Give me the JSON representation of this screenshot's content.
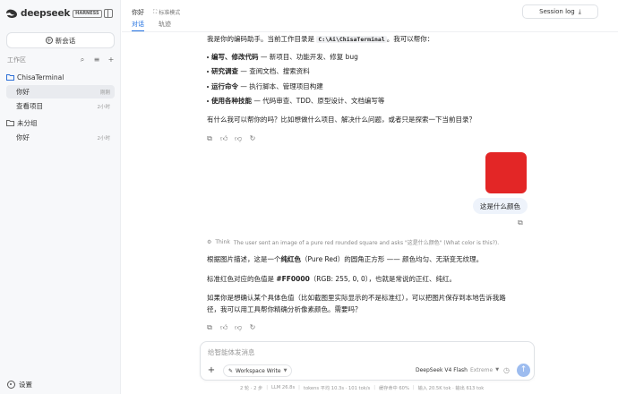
{
  "brand": {
    "name": "deepseek",
    "tag": "HARNESS"
  },
  "sidebar": {
    "new_chat": "新会话",
    "workspace_label": "工作区",
    "groups": [
      {
        "name": "ChisaTerminal",
        "items": [
          {
            "title": "你好",
            "time": "刚刚",
            "active": true
          },
          {
            "title": "查看项目",
            "time": "2小时",
            "active": false
          }
        ]
      },
      {
        "name": "未分组",
        "items": [
          {
            "title": "你好",
            "time": "2小时",
            "active": false
          }
        ]
      }
    ],
    "settings": "设置"
  },
  "header": {
    "title": "你好",
    "mode": "标准模式",
    "tabs": [
      {
        "label": "对话",
        "active": true
      },
      {
        "label": "轨迹",
        "active": false
      }
    ],
    "session_log": "Session log"
  },
  "messages": {
    "intro_a": "我是你的编码助手。当前工作目录是",
    "intro_path": "C:\\Ai\\ChisaTerminal",
    "intro_b": "。我可以帮你：",
    "bullets": [
      {
        "bold": "编写、修改代码",
        "rest": " — 新项目、功能开发、修复 bug"
      },
      {
        "bold": "研究调查",
        "rest": " — 查阅文档、搜索资料"
      },
      {
        "bold": "运行命令",
        "rest": " — 执行脚本、管理项目构建"
      },
      {
        "bold": "使用各种技能",
        "rest": " — 代码审查、TDD、原型设计、文档编写等"
      }
    ],
    "question": "有什么我可以帮你的吗？比如想做什么项目、解决什么问题，或者只是探索一下当前目录？",
    "user_text": "这是什么颜色",
    "think_label": "Think",
    "think_text": "The user sent an image of a pure red rounded square and asks \"这是什么颜色\" (What color is this?).",
    "answer1_a": "根据图片描述，这是一个",
    "answer1_bold": "纯红色",
    "answer1_b": "（Pure Red）的圆角正方形 —— 颜色均匀、无渐变无纹理。",
    "answer2_a": "标准红色对应的色值是 ",
    "answer2_bold": "#FF0000",
    "answer2_b": "（RGB: 255, 0, 0），也就是常说的正红、纯红。",
    "answer3_l1": "如果你是想确认某个具体色值（比如截图里实际显示的不是标准红），可以把图片保存到本地告诉我路",
    "answer3_l2": "径，我可以用工具帮你精确分析像素颜色。需要吗？"
  },
  "colors": {
    "image_swatch": "#e32626",
    "accent": "#1f6fe0",
    "send": "#9dbcef"
  },
  "input": {
    "placeholder": "给智能体发消息",
    "workspace_write": "Workspace Write",
    "model": "DeepSeek V4 Flash",
    "effort": "Extreme"
  },
  "status": [
    "2 轮 · 2 步",
    "LLM 26.8s",
    "tokens 平均 10.3s · 101 tok/s",
    "缓存命中 60%",
    "输入 20.5K tok · 输出 613 tok"
  ]
}
